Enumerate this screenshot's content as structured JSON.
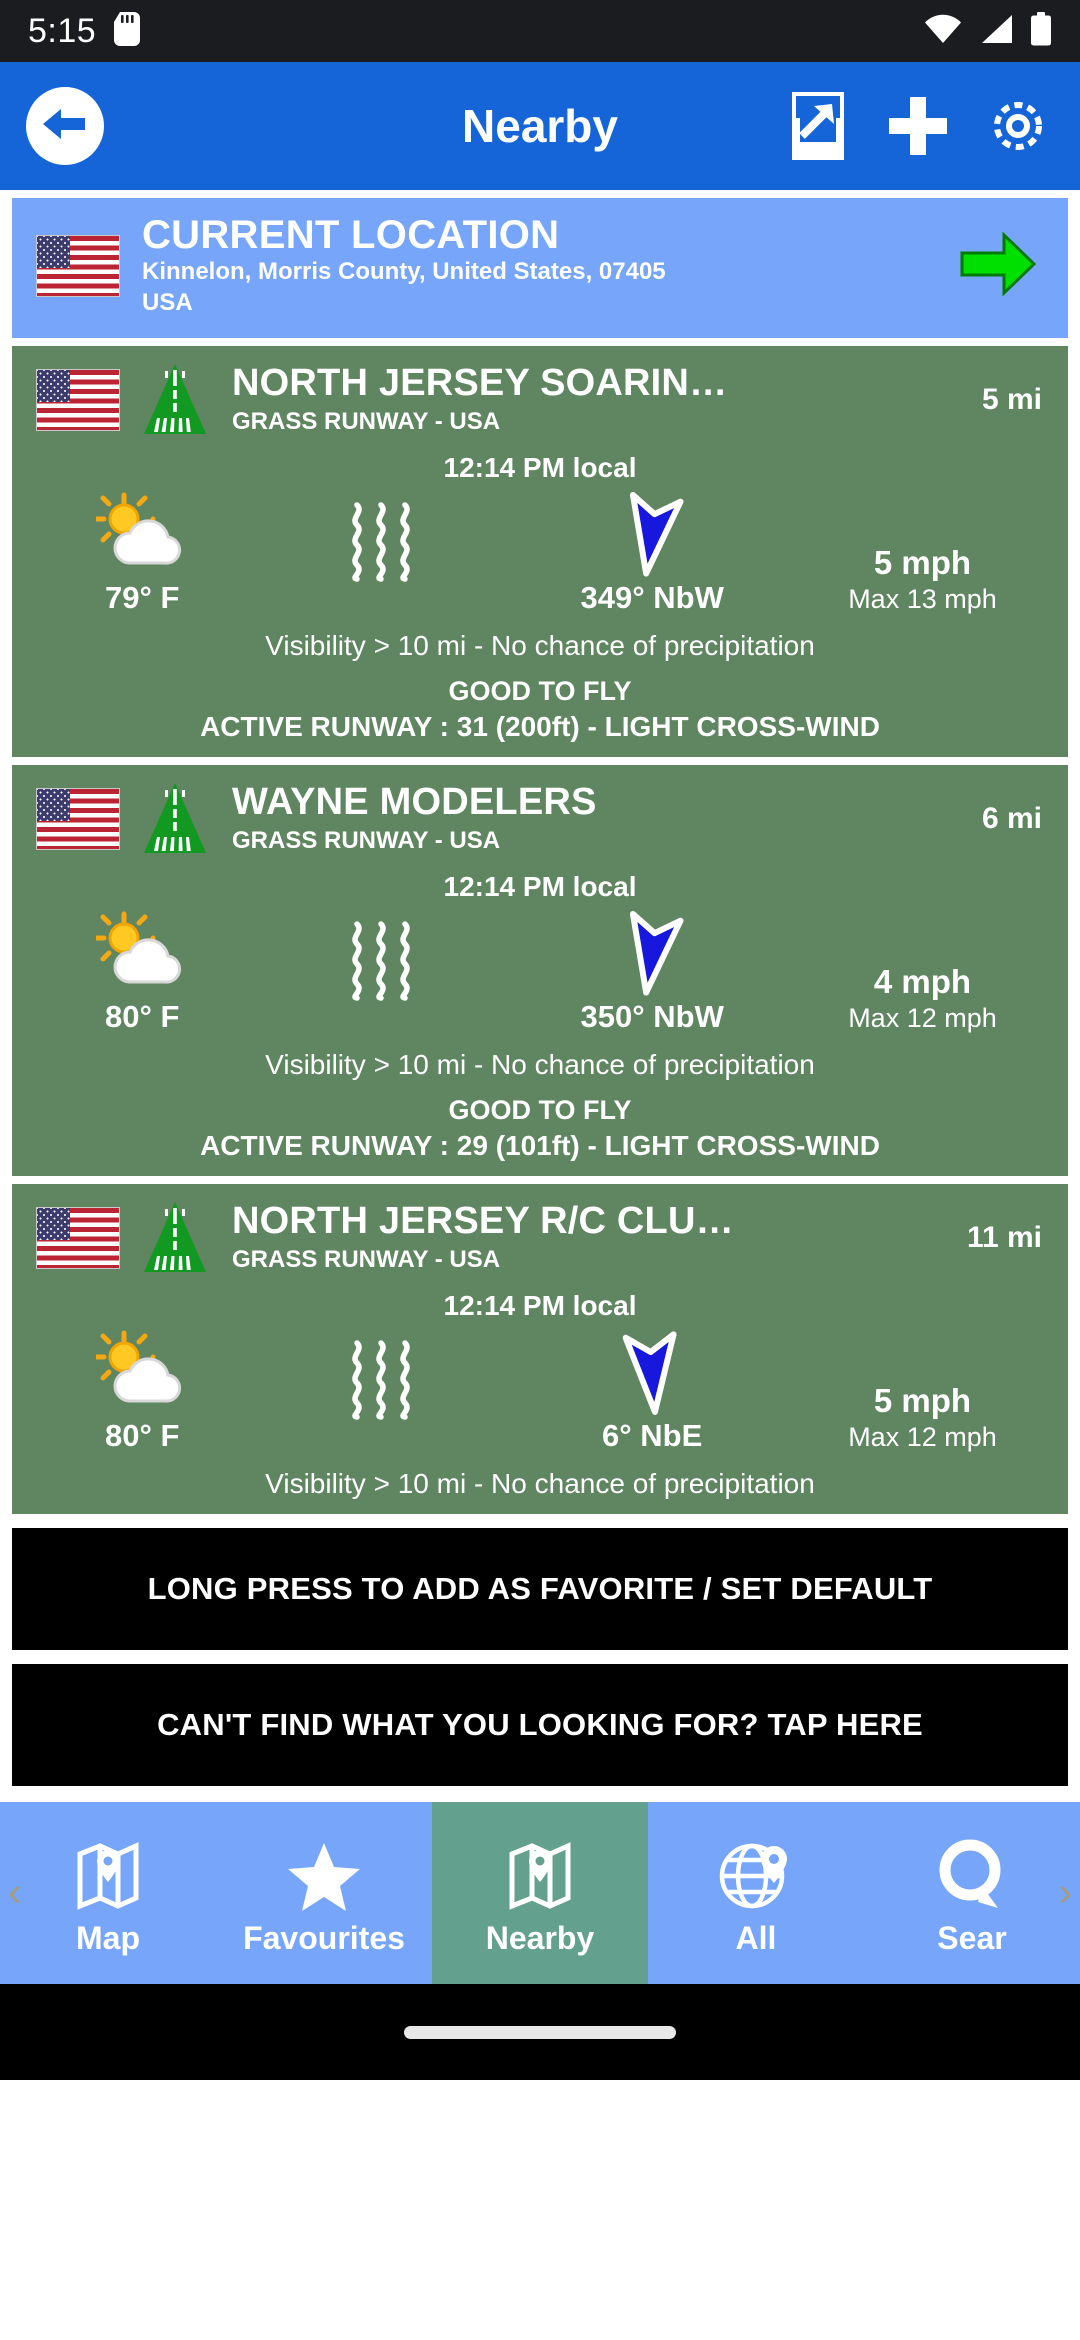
{
  "status_bar": {
    "time": "5:15",
    "icons": [
      "sd-card-icon",
      "wifi-icon",
      "cellular-signal-icon",
      "battery-icon"
    ]
  },
  "app_bar": {
    "title": "Nearby",
    "back_icon": "back-arrow-icon",
    "actions": [
      "share-export-icon",
      "plus-icon",
      "gear-icon"
    ]
  },
  "current_location": {
    "title": "CURRENT LOCATION",
    "address": "Kinnelon, Morris County, United States, 07405",
    "country": "USA",
    "flag": "us-flag-icon",
    "go_icon": "green-right-arrow-icon"
  },
  "cards": [
    {
      "name": "NORTH JERSEY SOARIN…",
      "subtitle": "GRASS RUNWAY - USA",
      "distance": "5 mi",
      "local_time": "12:14 PM local",
      "temperature": "79° F",
      "weather_icon": "sun-behind-cloud-icon",
      "humidity_icon": "wavy-lines-icon",
      "wind_direction": "349° NbW",
      "wind_arrow_icon": "wind-direction-arrow-icon",
      "wind_speed": "5 mph",
      "wind_max": "Max 13 mph",
      "visibility": "Visibility > 10 mi - No chance of precipitation",
      "status": "GOOD TO FLY",
      "runway": "ACTIVE RUNWAY : 31 (200ft) - LIGHT CROSS-WIND",
      "arrow_rotation": "8",
      "has_runway_line": true
    },
    {
      "name": "WAYNE MODELERS",
      "subtitle": "GRASS RUNWAY - USA",
      "distance": "6 mi",
      "local_time": "12:14 PM local",
      "temperature": "80° F",
      "weather_icon": "sun-behind-cloud-icon",
      "humidity_icon": "wavy-lines-icon",
      "wind_direction": "350° NbW",
      "wind_arrow_icon": "wind-direction-arrow-icon",
      "wind_speed": "4 mph",
      "wind_max": "Max 12 mph",
      "visibility": "Visibility > 10 mi - No chance of precipitation",
      "status": "GOOD TO FLY",
      "runway": "ACTIVE RUNWAY : 29 (101ft) - LIGHT CROSS-WIND",
      "arrow_rotation": "8",
      "has_runway_line": true
    },
    {
      "name": "NORTH JERSEY R/C CLU…",
      "subtitle": "GRASS RUNWAY - USA",
      "distance": "11 mi",
      "local_time": "12:14 PM local",
      "temperature": "80° F",
      "weather_icon": "sun-behind-cloud-icon",
      "humidity_icon": "wavy-lines-icon",
      "wind_direction": "6° NbE",
      "wind_arrow_icon": "wind-direction-arrow-icon",
      "wind_speed": "5 mph",
      "wind_max": "Max 12 mph",
      "visibility": "Visibility > 10 mi - No chance of precipitation",
      "status": "",
      "runway": "",
      "arrow_rotation": "-4",
      "has_runway_line": false
    }
  ],
  "banners": {
    "favorite": "LONG PRESS TO ADD AS FAVORITE / SET DEFAULT",
    "not_found": "CAN'T FIND WHAT YOU LOOKING FOR? TAP HERE"
  },
  "bottom_nav": {
    "items": [
      {
        "label": "Map",
        "icon": "map-pin-icon",
        "active": false
      },
      {
        "label": "Favourites",
        "icon": "star-icon",
        "active": false
      },
      {
        "label": "Nearby",
        "icon": "map-fold-pin-icon",
        "active": true
      },
      {
        "label": "All",
        "icon": "globe-pin-icon",
        "active": false
      },
      {
        "label": "Sear",
        "icon": "search-icon",
        "active": false
      }
    ],
    "prev_chevron": "‹",
    "next_chevron": "›"
  },
  "colors": {
    "appbar": "#1565d8",
    "banner": "#76a5fa",
    "card": "#5f8561",
    "active_tab": "#63a08d",
    "wind_arrow": "#1717dd",
    "go_arrow": "#00e000"
  }
}
